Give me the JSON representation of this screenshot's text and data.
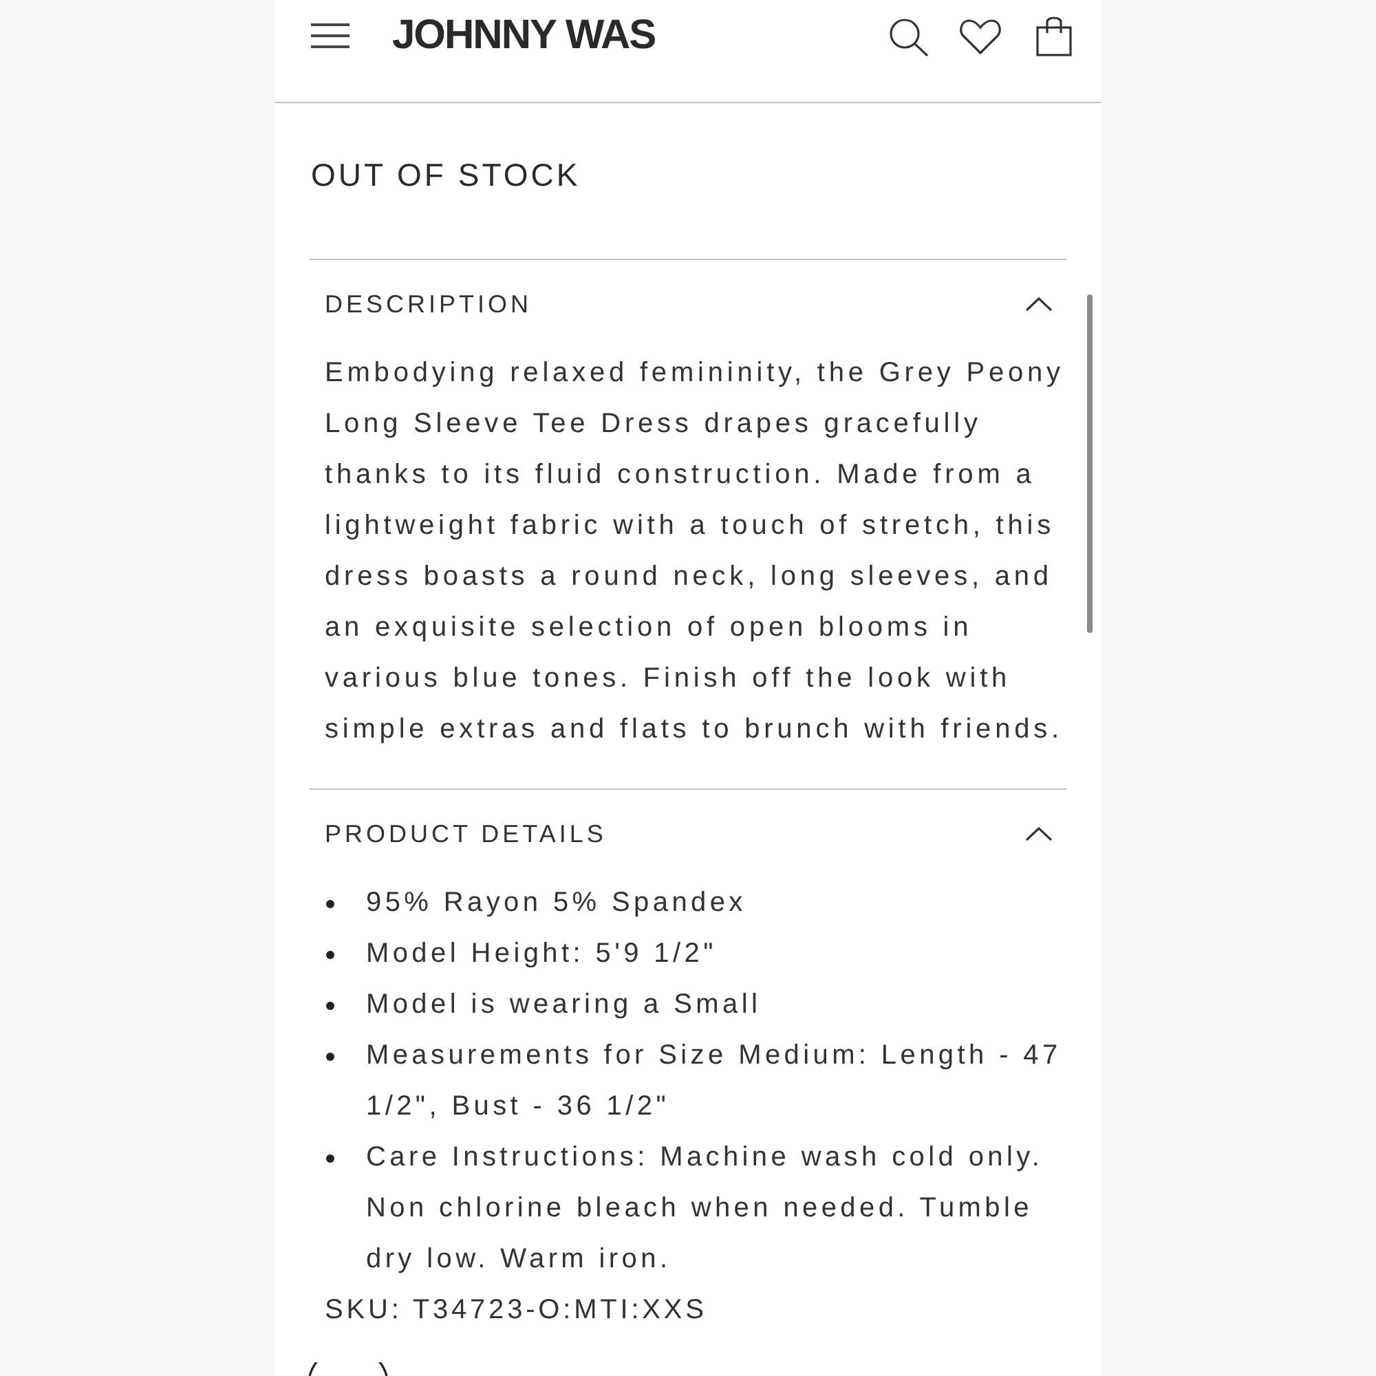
{
  "header": {
    "logo": "JOHNNY WAS"
  },
  "stock_status": "OUT OF STOCK",
  "sections": [
    {
      "kind": "paragraph",
      "title": "DESCRIPTION",
      "expanded": true,
      "text": "Embodying relaxed femininity, the Grey Peony Long Sleeve Tee Dress drapes gracefully thanks to its fluid construction. Made from a lightweight fabric with a touch of stretch, this dress boasts a round neck, long sleeves, and an exquisite selection of open blooms in various blue tones. Finish off the look with simple extras and flats to brunch with friends."
    },
    {
      "kind": "list",
      "title": "PRODUCT DETAILS",
      "expanded": true,
      "items": [
        "95% Rayon 5% Spandex",
        "Model Height: 5'9 1/2\"",
        "Model is wearing a Small",
        "Measurements for Size Medium: Length - 47 1/2\", Bust - 36 1/2\"",
        "Care Instructions: Machine wash cold only. Non chlorine bleach when needed. Tumble dry low. Warm iron."
      ],
      "sku": "SKU: T34723-O:MTI:XXS"
    }
  ]
}
